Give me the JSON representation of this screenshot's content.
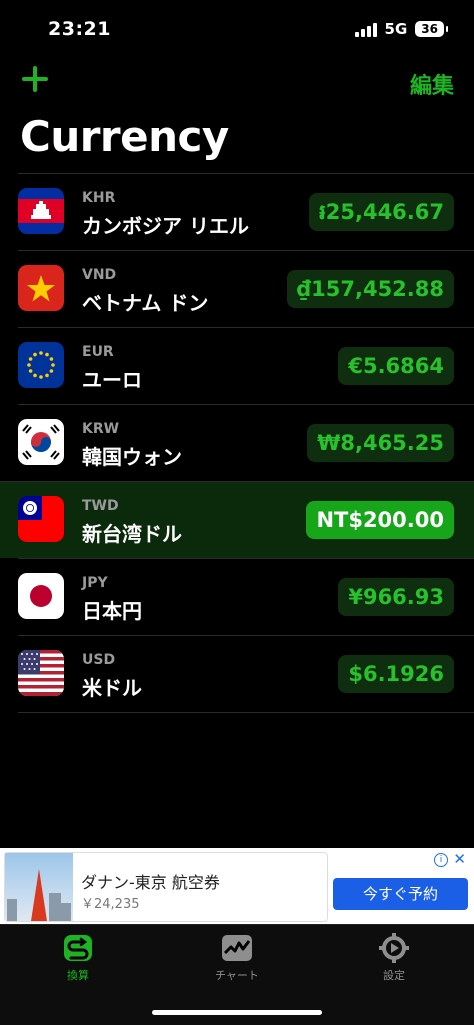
{
  "status_bar": {
    "time": "23:21",
    "network": "5G",
    "battery": "36"
  },
  "header": {
    "edit_label": "編集",
    "title": "Currency"
  },
  "currencies": [
    {
      "code": "KHR",
      "name": "カンボジア リエル",
      "amount": "៛25,446.67",
      "flag": "cambodia-flag-icon"
    },
    {
      "code": "VND",
      "name": "ベトナム ドン",
      "amount": "₫157,452.88",
      "flag": "vietnam-flag-icon"
    },
    {
      "code": "EUR",
      "name": "ユーロ",
      "amount": "€5.6864",
      "flag": "eu-flag-icon"
    },
    {
      "code": "KRW",
      "name": "韓国ウォン",
      "amount": "₩8,465.25",
      "flag": "korea-flag-icon"
    },
    {
      "code": "TWD",
      "name": "新台湾ドル",
      "amount": "NT$200.00",
      "flag": "taiwan-flag-icon",
      "selected": true
    },
    {
      "code": "JPY",
      "name": "日本円",
      "amount": "¥966.93",
      "flag": "japan-flag-icon"
    },
    {
      "code": "USD",
      "name": "米ドル",
      "amount": "$6.1926",
      "flag": "usa-flag-icon"
    }
  ],
  "ad": {
    "title": "ダナン-東京 航空券",
    "price": "￥24,235",
    "cta": "今すぐ予約"
  },
  "tabs": [
    {
      "label": "換算",
      "icon": "exchange-icon",
      "active": true
    },
    {
      "label": "チャート",
      "icon": "chart-icon",
      "active": false
    },
    {
      "label": "設定",
      "icon": "settings-icon",
      "active": false
    }
  ],
  "colors": {
    "accent": "#1eb322",
    "amount_text": "#27c22b",
    "selected_bg": "#0b2a0b"
  }
}
